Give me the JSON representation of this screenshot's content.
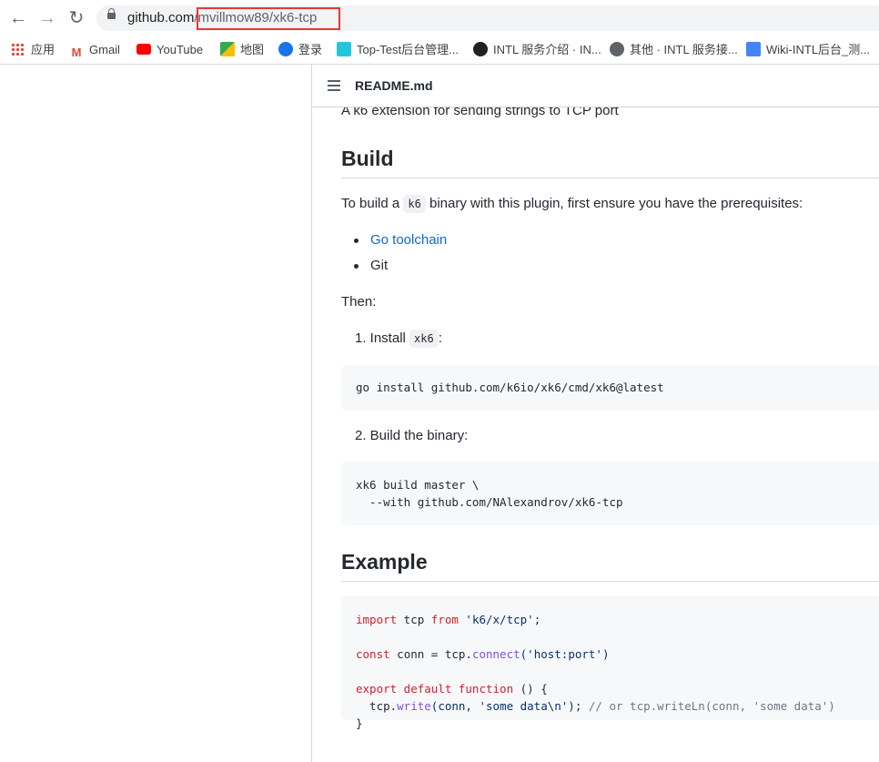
{
  "browser": {
    "url_host": "github.com",
    "url_path": "/mvillmow89/xk6-tcp"
  },
  "bookmarks": [
    {
      "label": "应用",
      "color": "#ea4335"
    },
    {
      "label": "Gmail",
      "color": "#ea4335"
    },
    {
      "label": "YouTube",
      "color": "#ff0000"
    },
    {
      "label": "地图",
      "color": "#34a853"
    },
    {
      "label": "登录",
      "color": "#1a73e8"
    },
    {
      "label": "Top-Test后台管理...",
      "color": "#26c6da"
    },
    {
      "label": "INTL 服务介绍 · IN...",
      "color": "#202124"
    },
    {
      "label": "其他 · INTL 服务接...",
      "color": "#5f6368"
    },
    {
      "label": "Wiki-INTL后台_测...",
      "color": "#4285f4"
    }
  ],
  "readme": {
    "title": "README.md",
    "intro": "A k6 extension for sending strings to TCP port",
    "build_heading": "Build",
    "build_text_before": "To build a ",
    "build_text_code": "k6",
    "build_text_after": " binary with this plugin, first ensure you have the prerequisites:",
    "prereqs": [
      "Go toolchain",
      "Git"
    ],
    "then": "Then:",
    "step1_prefix": "1. Install ",
    "step1_code": "xk6",
    "step1_suffix": ":",
    "step1_cmd": "go install github.com/k6io/xk6/cmd/xk6@latest",
    "step2": "2. Build the binary:",
    "step2_cmd_line1": "xk6 build master \\",
    "step2_cmd_line2": "  --with github.com/NAlexandrov/xk6-tcp",
    "example_heading": "Example",
    "example": {
      "l1_kw": "import",
      "l1_mid": " tcp ",
      "l1_kw2": "from",
      "l1_str": " 'k6/x/tcp'",
      "l1_end": ";",
      "l2_kw": "const",
      "l2_mid": " conn = tcp.",
      "l2_fn": "connect",
      "l2_str": "('host:port')",
      "l3_kw": "export default function",
      "l3_end": " () {",
      "l4_pre": "  tcp.",
      "l4_fn": "write",
      "l4_args": "(conn, 'some data\\n');",
      "l4_cm": " // or tcp.writeLn(conn, 'some data')",
      "l5": "}"
    }
  }
}
